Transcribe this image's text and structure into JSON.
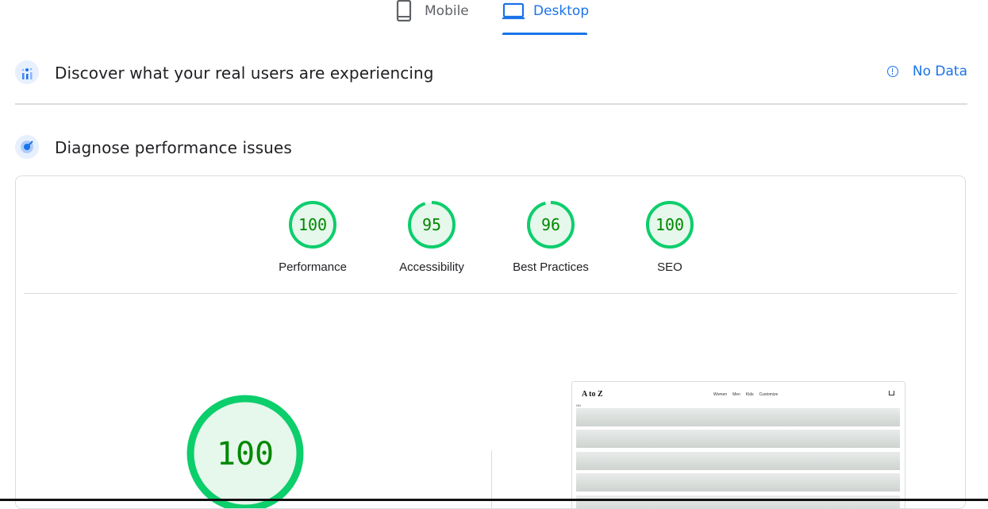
{
  "tabs": [
    {
      "label": "Mobile",
      "icon": "phone-icon",
      "active": false
    },
    {
      "label": "Desktop",
      "icon": "laptop-icon",
      "active": true
    }
  ],
  "crux": {
    "title": "Discover what your real users are experiencing",
    "status": "No Data",
    "icon": "crux-chart-icon",
    "status_icon": "info-icon"
  },
  "diagnose": {
    "title": "Diagnose performance issues",
    "icon": "lighthouse-icon"
  },
  "scores": [
    {
      "label": "Performance",
      "value": 100
    },
    {
      "label": "Accessibility",
      "value": 95
    },
    {
      "label": "Best Practices",
      "value": 96
    },
    {
      "label": "SEO",
      "value": 100
    }
  ],
  "big_score": {
    "value": 100
  },
  "thumbnail": {
    "logo": "A to Z",
    "nav": [
      "Women",
      "Men",
      "Kids",
      "Customize"
    ],
    "subtext": "NN"
  },
  "colors": {
    "accent": "#1a73e8",
    "pass": "#0cce6b",
    "pass_text": "#008800",
    "pass_fill": "#e6f7ec"
  }
}
